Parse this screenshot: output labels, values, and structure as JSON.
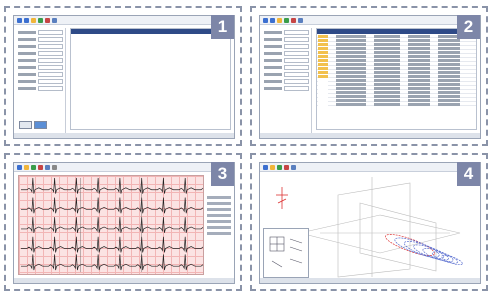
{
  "panels": [
    {
      "badge": "1"
    },
    {
      "badge": "2"
    },
    {
      "badge": "3"
    },
    {
      "badge": "4"
    }
  ],
  "colors": {
    "dash_border": "#8a93a8",
    "badge_bg": "#7d86a8",
    "ecg_grid": "#fbe3e3",
    "ecg_trace": "#222222",
    "list_highlight": "#f2c14e",
    "list_header": "#2e4a87"
  },
  "icons": [
    "back-icon",
    "forward-icon",
    "folder-icon",
    "save-icon",
    "print-icon",
    "search-icon"
  ]
}
